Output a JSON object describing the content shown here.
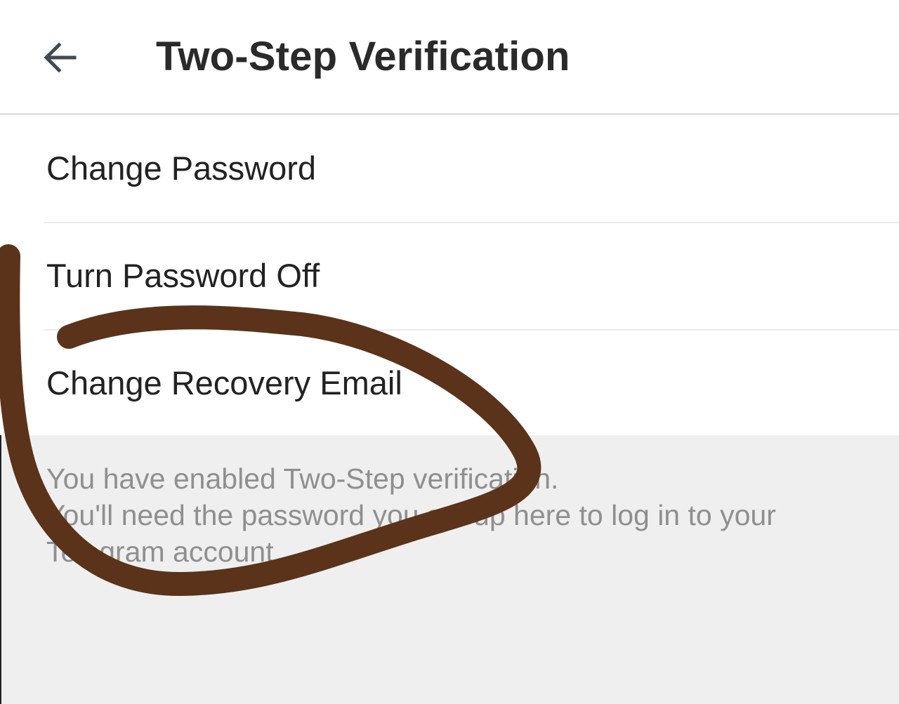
{
  "header": {
    "back_icon": "arrow-left-icon",
    "title": "Two-Step Verification"
  },
  "menu": {
    "items": [
      {
        "label": "Change Password"
      },
      {
        "label": "Turn Password Off"
      },
      {
        "label": "Change Recovery Email"
      }
    ]
  },
  "info": {
    "lines": [
      "You have enabled Two-Step verification.",
      "You'll need the password you set up here to log in to your",
      "Telegram account"
    ]
  },
  "annotation": {
    "type": "hand-drawn-loop",
    "color": "#5a331a"
  }
}
